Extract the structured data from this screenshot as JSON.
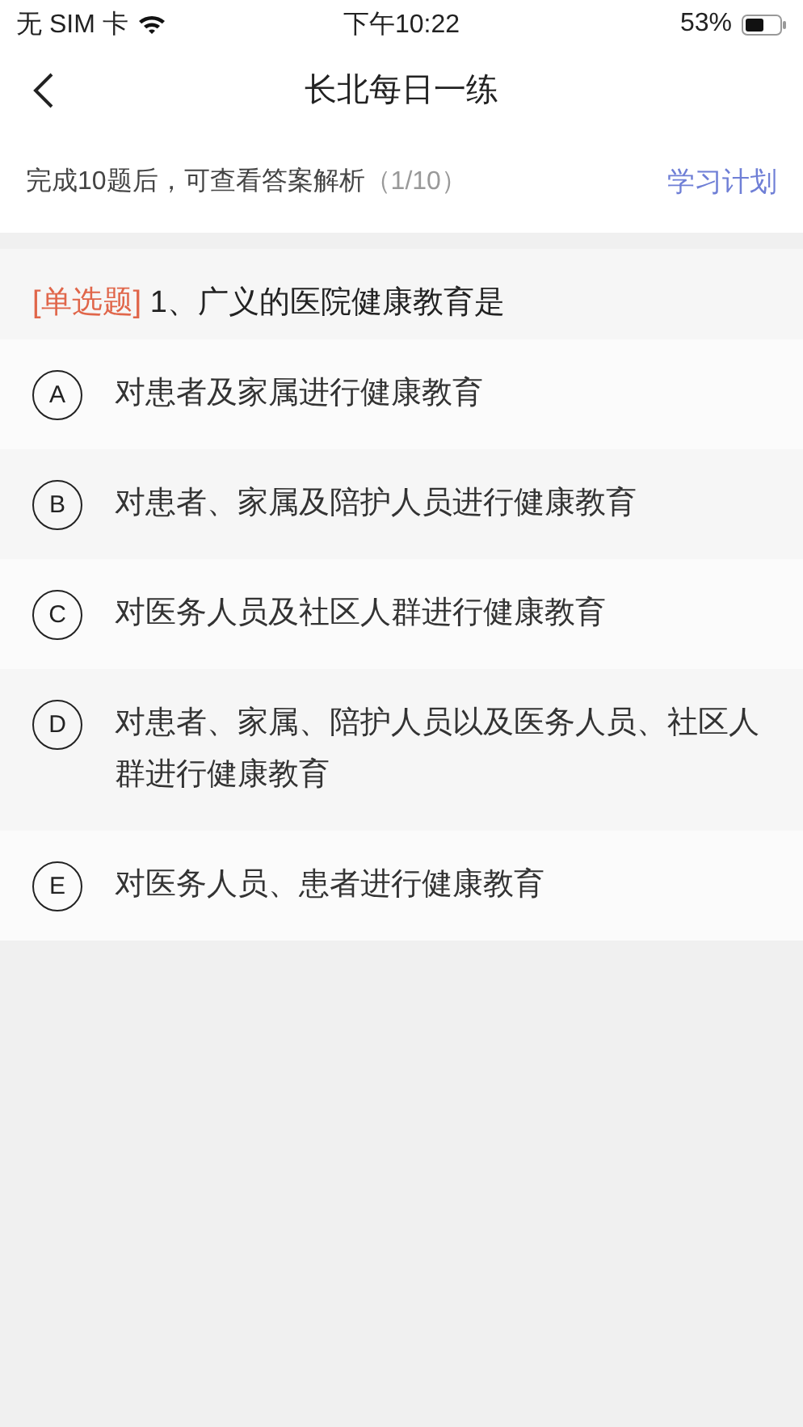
{
  "status_bar": {
    "carrier": "无 SIM 卡",
    "time": "下午10:22",
    "battery": "53%"
  },
  "nav": {
    "title": "长北每日一练"
  },
  "progress": {
    "hint": "完成10题后，可查看答案解析",
    "count": "（1/10）",
    "plan_link": "学习计划"
  },
  "question": {
    "type": "[单选题]",
    "text": "1、广义的医院健康教育是"
  },
  "options": [
    {
      "letter": "A",
      "text": "对患者及家属进行健康教育",
      "selected": false
    },
    {
      "letter": "B",
      "text": "对患者、家属及陪护人员进行健康教育",
      "selected": false
    },
    {
      "letter": "C",
      "text": "对医务人员及社区人群进行健康教育",
      "selected": false
    },
    {
      "letter": "D",
      "text": "对患者、家属、陪护人员以及医务人员、社区人群进行健康教育",
      "selected": false
    },
    {
      "letter": "E",
      "text": "对医务人员、患者进行健康教育",
      "selected": false
    }
  ]
}
